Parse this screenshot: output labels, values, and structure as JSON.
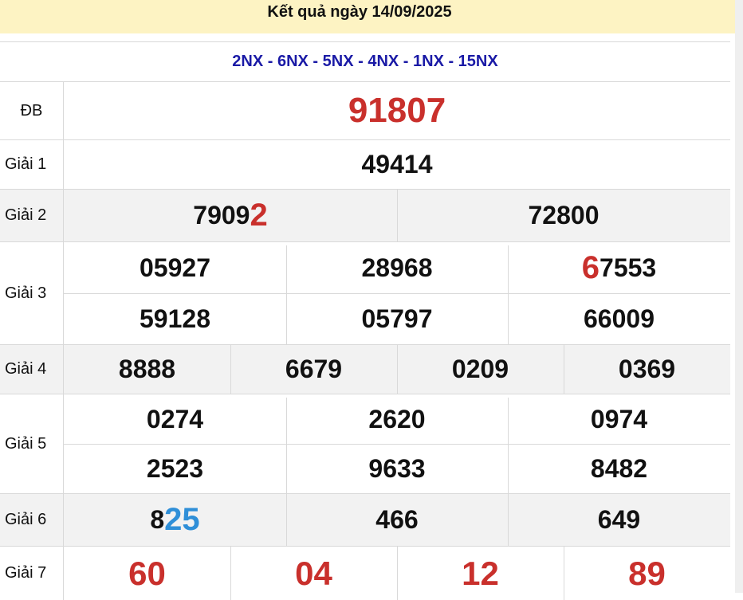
{
  "title": "Kết quả ngày 14/09/2025",
  "codes": "2NX - 6NX - 5NX - 4NX - 1NX - 15NX",
  "labels": {
    "db": "ĐB",
    "g1": "Giải 1",
    "g2": "Giải 2",
    "g3": "Giải 3",
    "g4": "Giải 4",
    "g5": "Giải 5",
    "g6": "Giải 6",
    "g7": "Giải 7"
  },
  "prizes": {
    "db": "91807",
    "g1": "49414",
    "g2": [
      {
        "main": "7909",
        "highlight": "2"
      },
      {
        "main": "72800",
        "highlight": ""
      }
    ],
    "g3": [
      {
        "prefix": "",
        "main": "05927"
      },
      {
        "prefix": "",
        "main": "28968"
      },
      {
        "prefix": "6",
        "main": "7553"
      },
      {
        "prefix": "",
        "main": "59128"
      },
      {
        "prefix": "",
        "main": "05797"
      },
      {
        "prefix": "",
        "main": "66009"
      }
    ],
    "g4": [
      "8888",
      "6679",
      "0209",
      "0369"
    ],
    "g5": [
      "0274",
      "2620",
      "0974",
      "2523",
      "9633",
      "8482"
    ],
    "g6": [
      {
        "main": "8",
        "highlight": "25"
      },
      {
        "main": "466",
        "highlight": ""
      },
      {
        "main": "649",
        "highlight": ""
      }
    ],
    "g7": [
      "60",
      "04",
      "12",
      "89"
    ]
  },
  "colors": {
    "header_bg": "#fdf3c3",
    "codes_text": "#1a1aa6",
    "highlight_red": "#c9302c",
    "highlight_blue": "#2f8fd8",
    "alt_row_bg": "#f2f2f2"
  }
}
